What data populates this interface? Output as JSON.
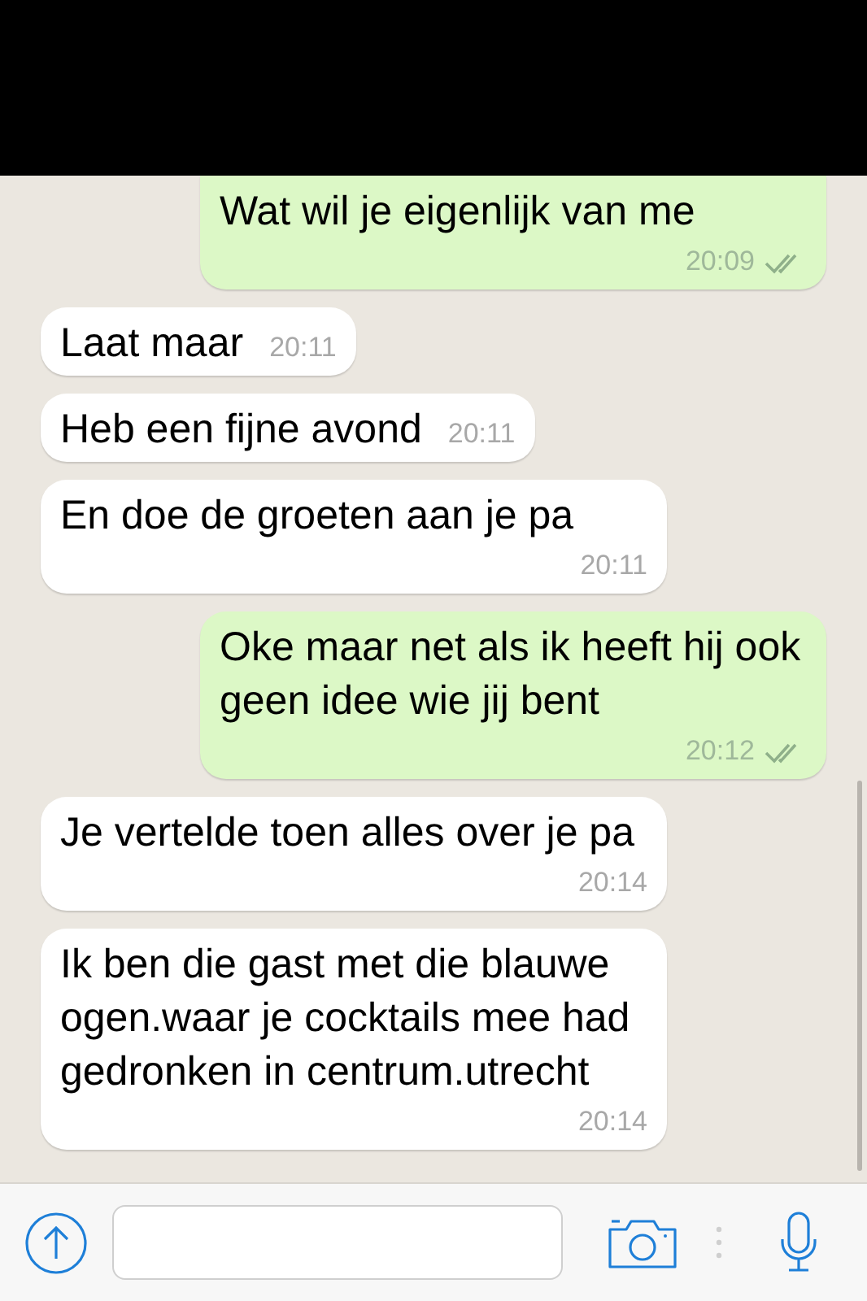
{
  "messages": [
    {
      "kind": "sent",
      "text": "Wat wil je eigenlijk van me",
      "time": "20:09",
      "delivered": true
    },
    {
      "kind": "received",
      "text": "Laat maar",
      "time": "20:11"
    },
    {
      "kind": "received",
      "text": "Heb een fijne avond",
      "time": "20:11"
    },
    {
      "kind": "received",
      "text": "En doe de groeten aan je pa",
      "time": "20:11"
    },
    {
      "kind": "sent",
      "text": "Oke maar net als ik heeft hij ook geen idee wie jij bent",
      "time": "20:12",
      "delivered": true
    },
    {
      "kind": "received",
      "text": "Je vertelde toen alles over je pa",
      "time": "20:14"
    },
    {
      "kind": "received",
      "text": "Ik ben die gast met die blauwe ogen.waar je cocktails mee had gedronken in centrum.utrecht",
      "time": "20:14"
    }
  ]
}
